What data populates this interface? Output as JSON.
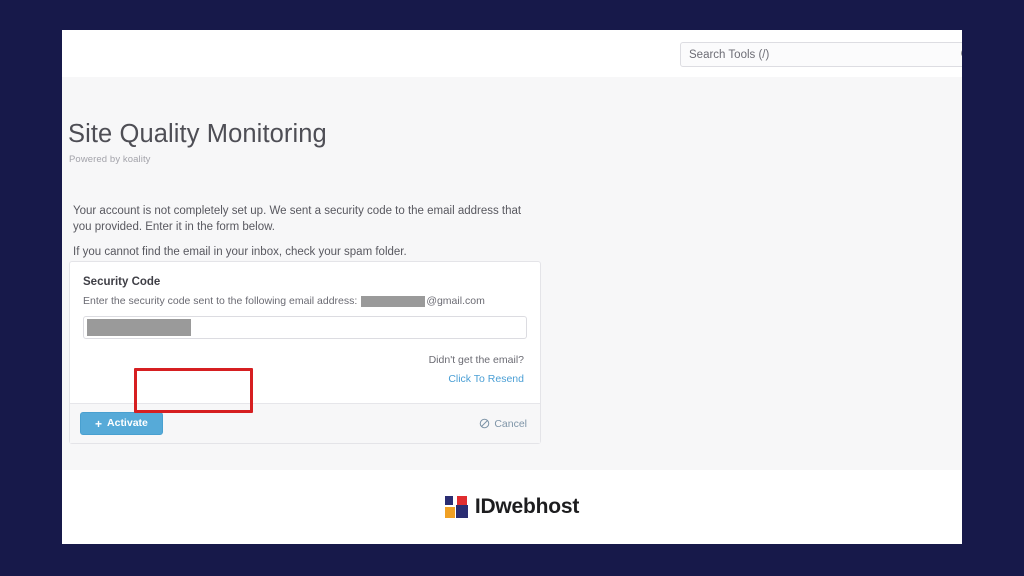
{
  "theme": {
    "outer_background": "#17194a",
    "page_background": "#f7f7f8",
    "accent_blue": "#56aad8",
    "link_blue": "#4b9fd5",
    "highlight_red": "#d61f21",
    "redaction_gray": "#9a9a9a"
  },
  "header": {
    "search": {
      "placeholder": "Search Tools (/)",
      "value": "",
      "icon": "search-icon"
    }
  },
  "page": {
    "title": "Site Quality Monitoring",
    "subtitle": "Powered by koality",
    "intro_paragraph_1": "Your account is not completely set up. We sent a security code to the email address that you provided. Enter it in the form below.",
    "intro_paragraph_2": "If you cannot find the email in your inbox, check your spam folder."
  },
  "security_card": {
    "title": "Security Code",
    "help_text_prefix": "Enter the security code sent to the following email address:",
    "email_redacted": true,
    "email_domain": "@gmail.com",
    "code_input": {
      "value": "",
      "placeholder": "",
      "redacted": true
    },
    "resend": {
      "question": "Didn't get the email?",
      "link_label": "Click To Resend"
    },
    "footer": {
      "activate_label": "Activate",
      "activate_icon": "plus-icon",
      "cancel_label": "Cancel",
      "cancel_icon": "ban-icon"
    }
  },
  "annotation": {
    "highlight_target": "activate-button",
    "color": "#d61f21"
  },
  "footer": {
    "brand_name": "IDwebhost",
    "logo_colors": {
      "top_left": "#2a2d72",
      "top_right": "#e02d2f",
      "bottom_left": "#f0a024",
      "bottom_right": "#2a2d72"
    }
  }
}
